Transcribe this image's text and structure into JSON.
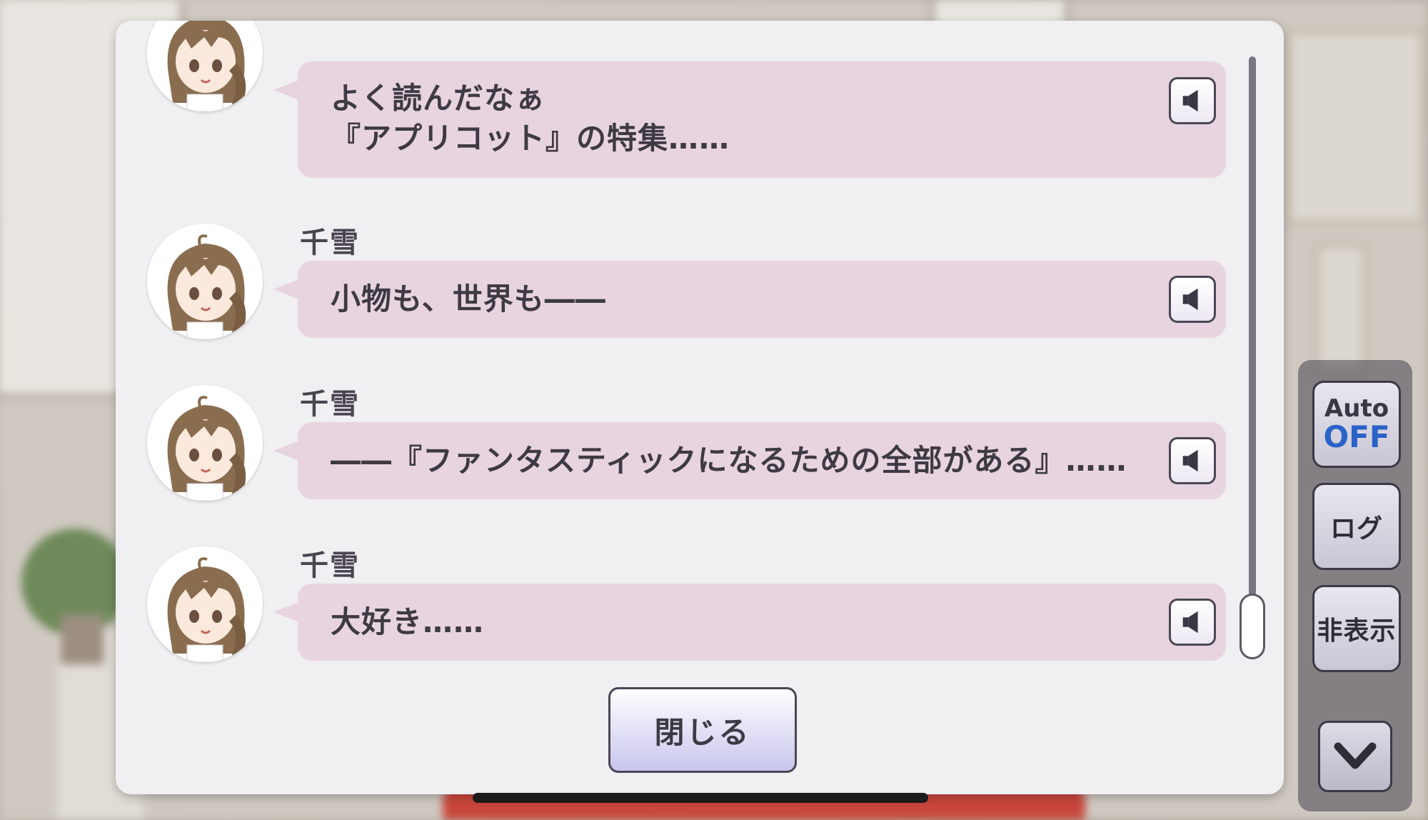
{
  "log_entries": [
    {
      "speaker": "",
      "text": "よく読んだなぁ\n『アプリコット』の特集……"
    },
    {
      "speaker": "千雪",
      "text": "小物も、世界も――"
    },
    {
      "speaker": "千雪",
      "text": "――『ファンタスティックになるための全部がある』……"
    },
    {
      "speaker": "千雪",
      "text": "大好き……"
    }
  ],
  "voice_icon": "speaker-icon",
  "close_label": "閉じる",
  "side_panel": {
    "auto_label": "Auto",
    "auto_state": "OFF",
    "log_label": "ログ",
    "hide_label": "非表示",
    "down_icon": "chevron-down-icon"
  },
  "colors": {
    "bubble": "#e8d4df",
    "dialog": "#f0eff1",
    "auto_state": "#2a62c8"
  }
}
